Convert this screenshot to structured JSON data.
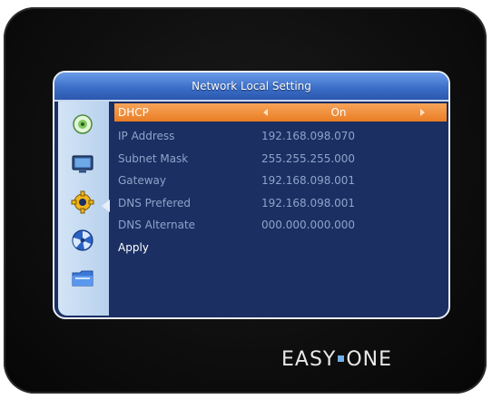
{
  "window": {
    "title": "Network Local Setting"
  },
  "sidebar": {
    "items": [
      {
        "icon": "disc-icon"
      },
      {
        "icon": "monitor-icon"
      },
      {
        "icon": "gear-icon"
      },
      {
        "icon": "satellite-dish-icon"
      },
      {
        "icon": "folder-icon"
      }
    ],
    "selected_index": 2
  },
  "settings": {
    "dhcp": {
      "label": "DHCP",
      "value": "On"
    },
    "ip_address": {
      "label": "IP Address",
      "value": "192.168.098.070"
    },
    "subnet_mask": {
      "label": "Subnet Mask",
      "value": "255.255.255.000"
    },
    "gateway": {
      "label": "Gateway",
      "value": "192.168.098.001"
    },
    "dns_preferred": {
      "label": "DNS Prefered",
      "value": "192.168.098.001"
    },
    "dns_alternate": {
      "label": "DNS Alternate",
      "value": "000.000.000.000"
    },
    "apply_label": "Apply"
  },
  "brand": {
    "left": "EASY",
    "right": "ONE"
  },
  "colors": {
    "selected_row": "#ea7d24",
    "screen_bg": "#1b2f63",
    "title_bar": "#3b6fc8",
    "dimmed_text": "#8fa3c9",
    "brand_dot": "#6fb0e8"
  }
}
